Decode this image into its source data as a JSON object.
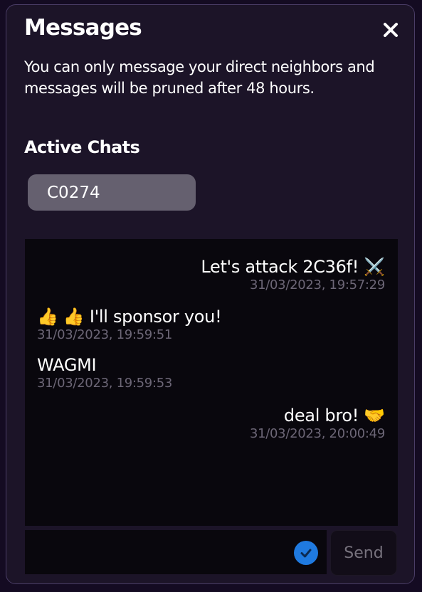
{
  "header": {
    "title": "Messages",
    "close_icon": "close-icon",
    "description": "You can only message your direct neighbors and messages will be pruned after 48 hours."
  },
  "active_chats": {
    "heading": "Active Chats",
    "items": [
      {
        "label": "C0274"
      }
    ]
  },
  "messages": [
    {
      "side": "right",
      "text": "Let's attack 2C36f! ⚔️",
      "timestamp": "31/03/2023, 19:57:29"
    },
    {
      "side": "left",
      "text": "👍 👍 I'll sponsor you!",
      "timestamp": "31/03/2023, 19:59:51"
    },
    {
      "side": "left",
      "text": "WAGMI",
      "timestamp": "31/03/2023, 19:59:53"
    },
    {
      "side": "right",
      "text": "deal bro! 🤝",
      "timestamp": "31/03/2023, 20:00:49"
    }
  ],
  "composer": {
    "value": "",
    "placeholder": "",
    "verified_icon": "check-circle-icon",
    "send_label": "Send"
  },
  "colors": {
    "background": "#140b22",
    "panel": "#1c1428",
    "chat_pill": "#65606f",
    "message_area": "#09070d",
    "timestamp": "#6c6676",
    "check_badge": "#1f7ae0",
    "send_text": "#77727d"
  }
}
